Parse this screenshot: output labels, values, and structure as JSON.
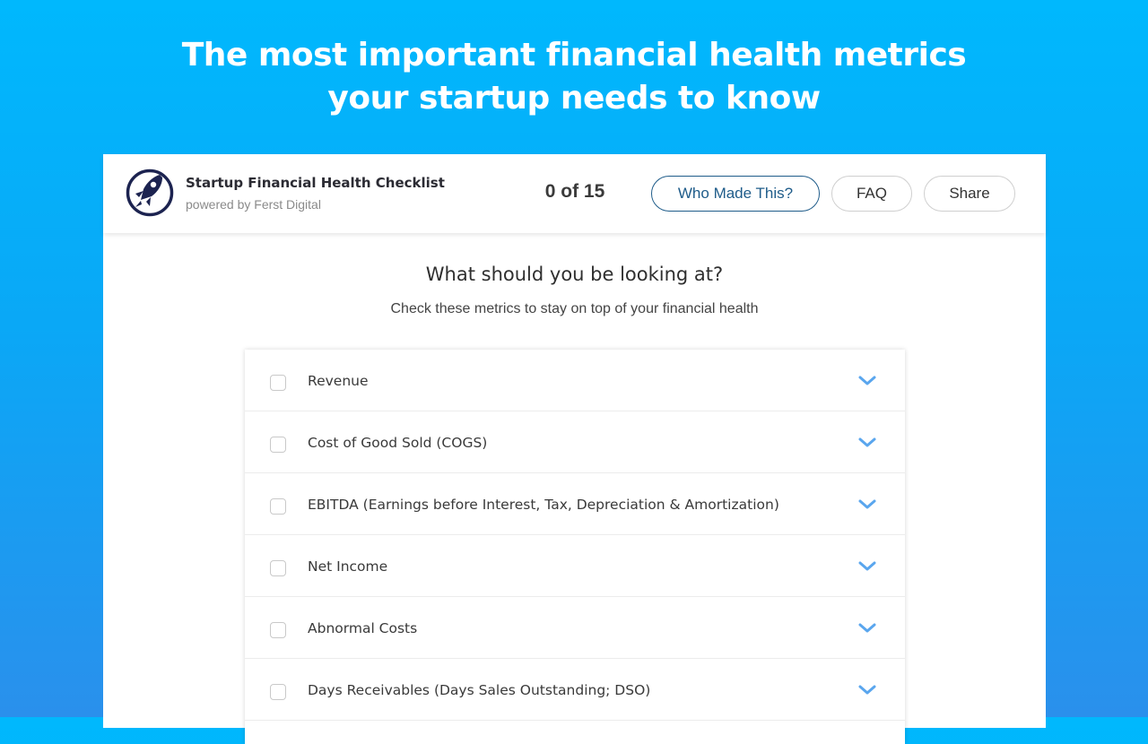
{
  "hero": {
    "line1": "The most important financial health metrics",
    "line2": "your startup needs to know"
  },
  "header": {
    "logo_icon": "rocket-icon",
    "title": "Startup Financial Health Checklist",
    "subtitle": "powered by Ferst Digital",
    "progress": "0 of 15",
    "buttons": {
      "who": "Who Made This?",
      "faq": "FAQ",
      "share": "Share"
    }
  },
  "section": {
    "title": "What should you be looking at?",
    "subtitle": "Check these metrics to stay on top of your financial health"
  },
  "checklist": {
    "items": [
      {
        "label": "Revenue",
        "checked": false
      },
      {
        "label": "Cost of Good Sold (COGS)",
        "checked": false
      },
      {
        "label": "EBITDA (Earnings before Interest, Tax, Depreciation & Amortization)",
        "checked": false
      },
      {
        "label": "Net Income",
        "checked": false
      },
      {
        "label": "Abnormal Costs",
        "checked": false
      },
      {
        "label": "Days Receivables (Days Sales Outstanding; DSO)",
        "checked": false
      }
    ]
  },
  "colors": {
    "background_top": "#00b8fd",
    "background_bottom": "#2a90ec",
    "brand_navy": "#1c2350",
    "button_accent": "#1f5c8a",
    "chevron": "#5aa6ee"
  }
}
